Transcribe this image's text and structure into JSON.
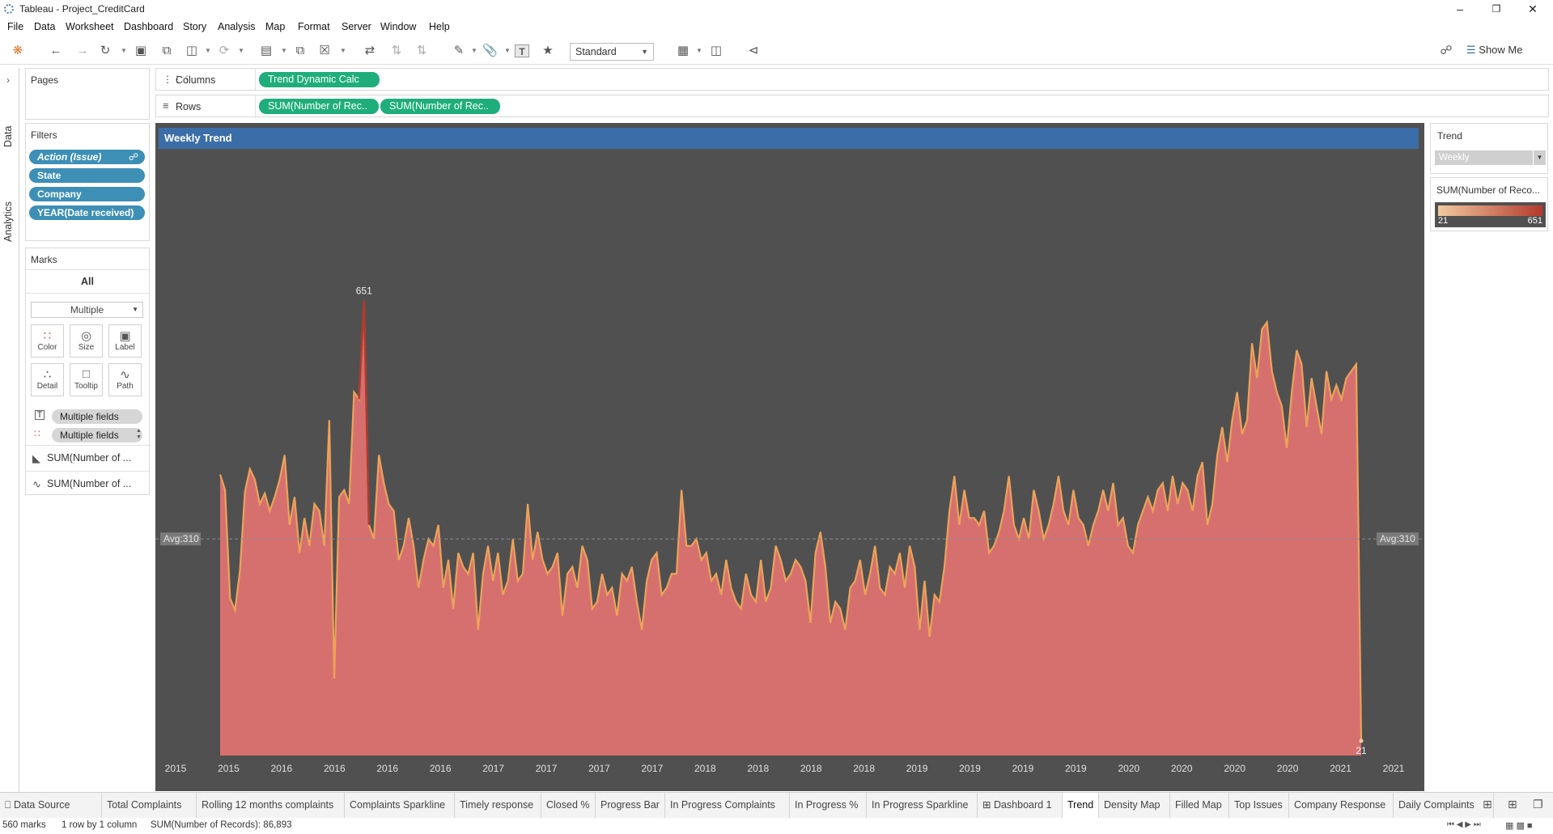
{
  "window": {
    "title": "Tableau - Project_CreditCard"
  },
  "menu": [
    "File",
    "Data",
    "Worksheet",
    "Dashboard",
    "Story",
    "Analysis",
    "Map",
    "Format",
    "Server",
    "Window",
    "Help"
  ],
  "toolbar": {
    "fit_select": "Standard",
    "show_me": "Show Me"
  },
  "side_tabs": {
    "data": "Data",
    "analytics": "Analytics"
  },
  "pages": {
    "title": "Pages"
  },
  "filters": {
    "title": "Filters",
    "items": [
      "Action (Issue)",
      "State",
      "Company",
      "YEAR(Date received)"
    ]
  },
  "marks": {
    "title": "Marks",
    "all_label": "All",
    "mark_type": "Multiple",
    "buttons": [
      "Color",
      "Size",
      "Label",
      "Detail",
      "Tooltip",
      "Path"
    ],
    "fields": [
      "Multiple fields",
      "Multiple fields"
    ],
    "measures": [
      "SUM(Number of ...",
      "SUM(Number of ..."
    ]
  },
  "columns_shelf": {
    "label": "Columns",
    "pills": [
      "Trend Dynamic Calc"
    ]
  },
  "rows_shelf": {
    "label": "Rows",
    "pills": [
      "SUM(Number of Rec..",
      "SUM(Number of Rec.."
    ]
  },
  "view": {
    "title": "Weekly Trend",
    "avg_label_left": "Avg:310",
    "avg_label_right": "Avg:310"
  },
  "legend": {
    "trend_title": "Trend",
    "trend_value": "Weekly",
    "color_title": "SUM(Number of Reco...",
    "color_min": "21",
    "color_max": "651",
    "color_from": "#f0c9a0",
    "color_to": "#b23a2e"
  },
  "chart_data": {
    "type": "area",
    "title": "Weekly Trend",
    "xlabel": "",
    "ylabel": "",
    "x_tick_labels": [
      "2015",
      "2015",
      "2016",
      "2016",
      "2016",
      "2016",
      "2017",
      "2017",
      "2017",
      "2017",
      "2018",
      "2018",
      "2018",
      "2018",
      "2019",
      "2019",
      "2019",
      "2019",
      "2020",
      "2020",
      "2020",
      "2020",
      "2021",
      "2021"
    ],
    "ylim": [
      0,
      720
    ],
    "average": 310,
    "max_label": "651",
    "min_label": "21",
    "series": [
      {
        "values": [
          402,
          380,
          225,
          208,
          265,
          378,
          410,
          395,
          360,
          375,
          350,
          370,
          395,
          430,
          330,
          370,
          290,
          340,
          300,
          360,
          350,
          300,
          480,
          110,
          370,
          380,
          360,
          520,
          510,
          651,
          330,
          310,
          430,
          390,
          360,
          350,
          280,
          300,
          340,
          300,
          240,
          280,
          310,
          300,
          330,
          240,
          280,
          210,
          290,
          270,
          260,
          290,
          180,
          260,
          300,
          250,
          290,
          230,
          250,
          310,
          250,
          260,
          360,
          280,
          320,
          280,
          260,
          270,
          290,
          200,
          260,
          270,
          240,
          300,
          280,
          210,
          220,
          260,
          230,
          240,
          200,
          260,
          250,
          270,
          220,
          180,
          250,
          280,
          290,
          230,
          240,
          260,
          260,
          380,
          300,
          300,
          310,
          280,
          290,
          250,
          260,
          230,
          280,
          240,
          220,
          210,
          260,
          230,
          220,
          280,
          220,
          240,
          300,
          280,
          250,
          260,
          280,
          270,
          250,
          190,
          290,
          320,
          270,
          190,
          220,
          210,
          180,
          240,
          250,
          280,
          230,
          260,
          300,
          240,
          230,
          270,
          260,
          290,
          240,
          300,
          270,
          180,
          250,
          170,
          230,
          220,
          270,
          350,
          400,
          330,
          380,
          340,
          340,
          330,
          350,
          290,
          300,
          320,
          350,
          400,
          330,
          310,
          340,
          310,
          380,
          350,
          310,
          330,
          360,
          400,
          350,
          330,
          380,
          340,
          330,
          300,
          330,
          350,
          380,
          350,
          390,
          330,
          340,
          300,
          290,
          330,
          350,
          370,
          350,
          380,
          390,
          350,
          400,
          360,
          390,
          380,
          350,
          400,
          420,
          330,
          360,
          430,
          470,
          420,
          480,
          520,
          460,
          480,
          590,
          540,
          610,
          620,
          550,
          520,
          500,
          440,
          520,
          580,
          560,
          470,
          540,
          500,
          460,
          550,
          510,
          530,
          510,
          540,
          550,
          560,
          21
        ]
      }
    ]
  },
  "sheet_tabs": [
    "Data Source",
    "Total Complaints",
    "Rolling 12 months complaints",
    "Complaints Sparkline",
    "Timely response",
    "Closed %",
    "Progress Bar",
    "In Progress Complaints",
    "In Progress %",
    "In Progress Sparkline",
    "Dashboard 1",
    "Trend",
    "Density Map",
    "Filled Map",
    "Top Issues",
    "Company Response",
    "Daily Complaints"
  ],
  "active_tab": "Trend",
  "status": {
    "marks": "560 marks",
    "dims": "1 row by 1 column",
    "sum": "SUM(Number of Records): 86,893"
  }
}
